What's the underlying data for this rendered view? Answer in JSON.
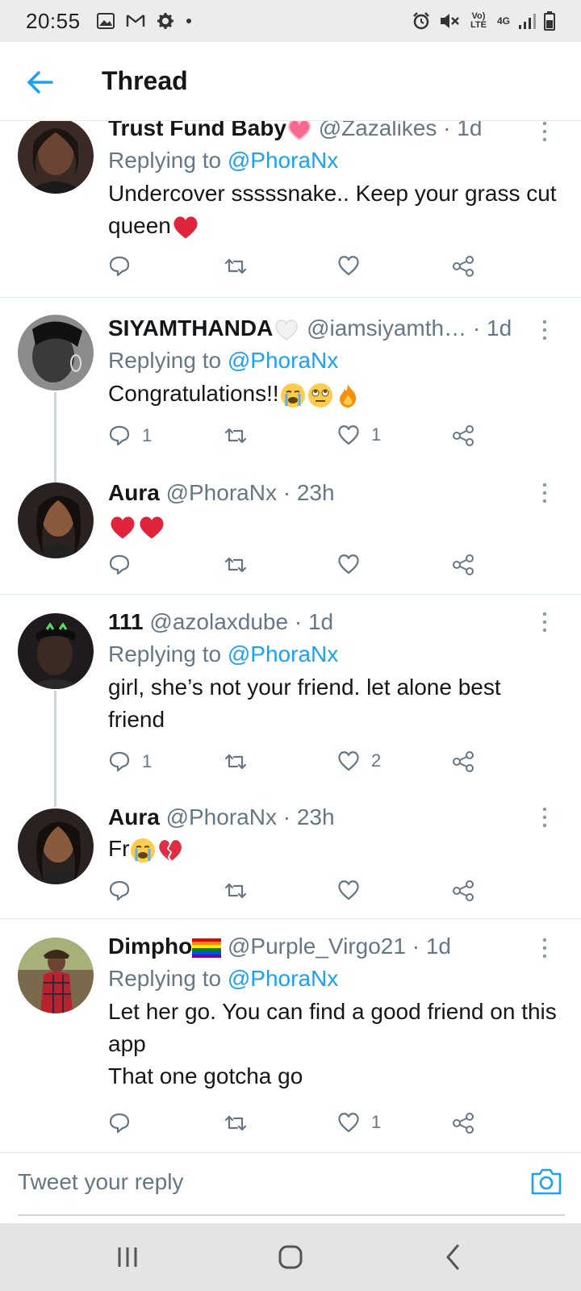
{
  "status_bar": {
    "time": "20:55",
    "network": "Vo) LTE",
    "network_type": "4G"
  },
  "header": {
    "title": "Thread",
    "back_icon": "arrow-left-icon"
  },
  "colors": {
    "accent": "#1da1f2",
    "text": "#14171a",
    "muted": "#657786",
    "divider": "#e1e8ed",
    "heart": "#e0245e"
  },
  "tweets": [
    {
      "name": "Trust Fund Baby",
      "name_emoji": "pink-heart",
      "handle": "@Zazalikes",
      "time": "· 1d",
      "replying_prefix": "Replying to",
      "replying_to": "@PhoraNx",
      "text": "Undercover sssssnake.. Keep your grass cut queen",
      "text_emoji": "red-heart",
      "reply_count": "",
      "like_count": ""
    },
    {
      "name": "SIYAMTHANDA",
      "name_emoji": "white-heart",
      "handle": "@iamsiyamth…",
      "time": "· 1d",
      "replying_prefix": "Replying to",
      "replying_to": "@PhoraNx",
      "text": "Congratulations!!",
      "text_emoji": "crying-face rolling-eyes fire",
      "reply_count": "1",
      "like_count": "1"
    },
    {
      "name": "Aura",
      "handle": "@PhoraNx",
      "time": "· 23h",
      "text_emoji": "red-heart red-heart",
      "reply_count": "",
      "like_count": ""
    },
    {
      "name": "111",
      "handle": "@azolaxdube",
      "time": "· 1d",
      "replying_prefix": "Replying to",
      "replying_to": "@PhoraNx",
      "text": "girl, she’s not your friend. let alone best friend",
      "reply_count": "1",
      "like_count": "2"
    },
    {
      "name": "Aura",
      "handle": "@PhoraNx",
      "time": "· 23h",
      "text": "Fr",
      "text_emoji": "crying-face broken-heart",
      "reply_count": "",
      "like_count": ""
    },
    {
      "name": "Dimpho",
      "name_emoji": "rainbow-flag",
      "handle": "@Purple_Virgo21",
      "time": "· 1d",
      "replying_prefix": "Replying to",
      "replying_to": "@PhoraNx",
      "text_line1": "Let her go. You can find a good friend on this app",
      "text_line2": "That one gotcha go",
      "reply_count": "",
      "like_count": "1"
    }
  ],
  "reply_box": {
    "placeholder": "Tweet your reply",
    "camera_icon": "camera-icon"
  },
  "nav": {
    "recents_icon": "recents-icon",
    "home_icon": "home-icon",
    "back_icon": "back-icon"
  }
}
